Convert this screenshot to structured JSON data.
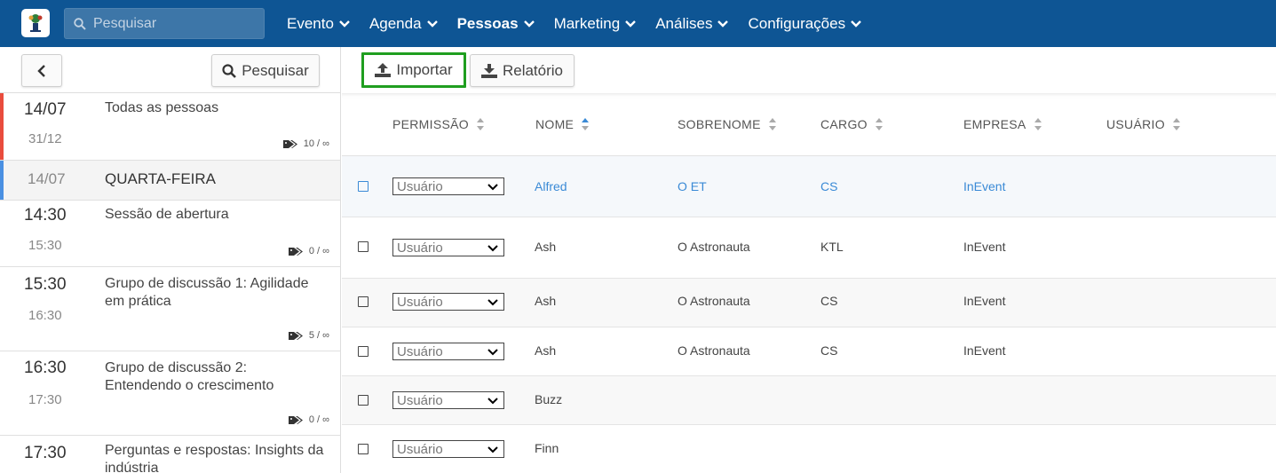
{
  "colors": {
    "nav_bg": "#0e5594",
    "accent_green": "#1f9e1f",
    "link_blue": "#3a8ad6",
    "stripe_red": "#e94c3d",
    "stripe_blue": "#4a90e2"
  },
  "nav": {
    "search_placeholder": "Pesquisar",
    "menu": [
      {
        "label": "Evento",
        "active": false
      },
      {
        "label": "Agenda",
        "active": false
      },
      {
        "label": "Pessoas",
        "active": true
      },
      {
        "label": "Marketing",
        "active": false
      },
      {
        "label": "Análises",
        "active": false
      },
      {
        "label": "Configurações",
        "active": false
      }
    ]
  },
  "left": {
    "search_label": "Pesquisar",
    "items": [
      {
        "start": "14/07",
        "end": "31/12",
        "title": "Todas as pessoas",
        "count": "10 / ∞"
      },
      {
        "start": "14/07",
        "title": "QUARTA-FEIRA"
      },
      {
        "start": "14:30",
        "end": "15:30",
        "title": "Sessão de abertura",
        "count": "0 / ∞"
      },
      {
        "start": "15:30",
        "end": "16:30",
        "title": "Grupo de discussão 1: Agilidade em prática",
        "count": "5 / ∞"
      },
      {
        "start": "16:30",
        "end": "17:30",
        "title": "Grupo de discussão 2: Entendendo o crescimento",
        "count": "0 / ∞"
      },
      {
        "start": "17:30",
        "title": "Perguntas e respostas: Insights da indústria"
      }
    ]
  },
  "toolbar": {
    "import_label": "Importar",
    "report_label": "Relatório"
  },
  "table": {
    "columns": [
      "PERMISSÃO",
      "NOME",
      "SOBRENOME",
      "CARGO",
      "EMPRESA",
      "USUÁRIO"
    ],
    "rows": [
      {
        "permission": "Usuário",
        "first": "Alfred",
        "last": "O ET",
        "role": "CS",
        "company": "InEvent"
      },
      {
        "permission": "Usuário",
        "first": "Ash",
        "last": "O Astronauta",
        "role": "KTL",
        "company": "InEvent"
      },
      {
        "permission": "Usuário",
        "first": "Ash",
        "last": "O Astronauta",
        "role": "CS",
        "company": "InEvent"
      },
      {
        "permission": "Usuário",
        "first": "Ash",
        "last": "O Astronauta",
        "role": "CS",
        "company": "InEvent"
      },
      {
        "permission": "Usuário",
        "first": "Buzz",
        "last": "",
        "role": "",
        "company": ""
      },
      {
        "permission": "Usuário",
        "first": "Finn",
        "last": "",
        "role": "",
        "company": ""
      }
    ]
  }
}
